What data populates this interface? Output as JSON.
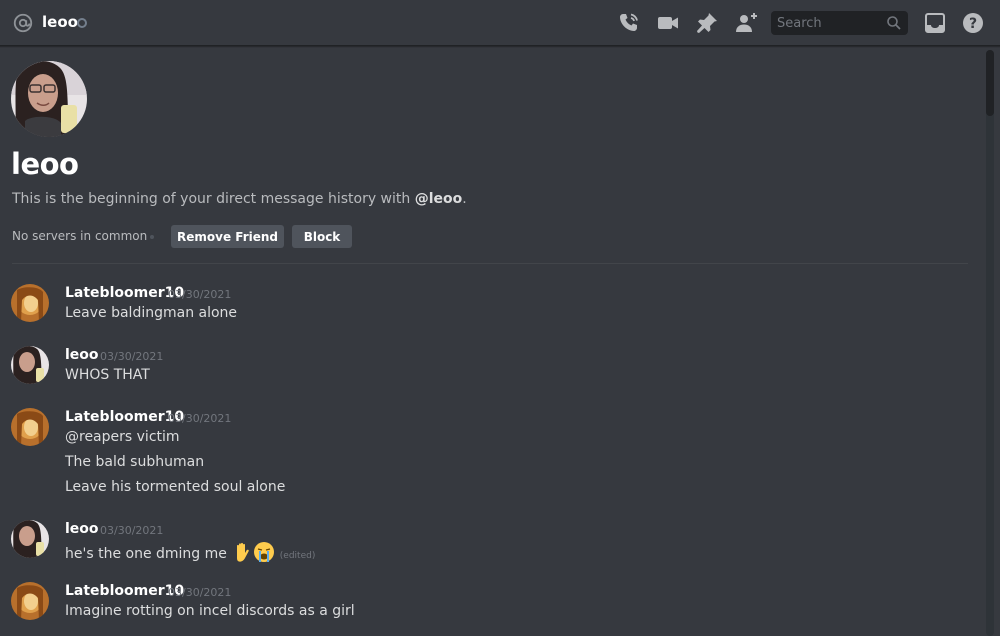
{
  "header": {
    "username": "leoo",
    "search_placeholder": "Search",
    "icons": [
      "at-icon",
      "call-icon",
      "video-icon",
      "pin-icon",
      "add-friend-icon",
      "search-icon",
      "inbox-icon",
      "help-icon"
    ]
  },
  "intro": {
    "title": "leoo",
    "description_prefix": "This is the beginning of your direct message history with ",
    "description_mention": "@leoo",
    "description_suffix": ".",
    "mutual_servers": "No servers in common",
    "remove_friend_label": "Remove Friend",
    "block_label": "Block"
  },
  "messages": [
    {
      "author": "Latebloomer10",
      "timestamp": "03/30/2021",
      "lines": [
        "Leave baldingman alone"
      ]
    },
    {
      "author": "leoo",
      "timestamp": "03/30/2021",
      "lines": [
        "WHOS THAT"
      ]
    },
    {
      "author": "Latebloomer10",
      "timestamp": "03/30/2021",
      "lines": [
        "@reapers victim",
        "The bald subhuman",
        "Leave his tormented soul alone"
      ]
    },
    {
      "author": "leoo",
      "timestamp": "03/30/2021",
      "lines": [
        "he's the one dming me"
      ],
      "emojis": [
        "raised-hand",
        "loudly-crying-face"
      ],
      "edited_label": "(edited)"
    },
    {
      "author": "Latebloomer10",
      "timestamp": "03/30/2021",
      "lines": [
        "Imagine rotting on incel discords as a girl"
      ]
    }
  ],
  "colors": {
    "background": "#36393f",
    "header_border": "#202225",
    "button": "#4f545c",
    "muted_text": "#72767d",
    "secondary_text": "#b9bbbe"
  }
}
